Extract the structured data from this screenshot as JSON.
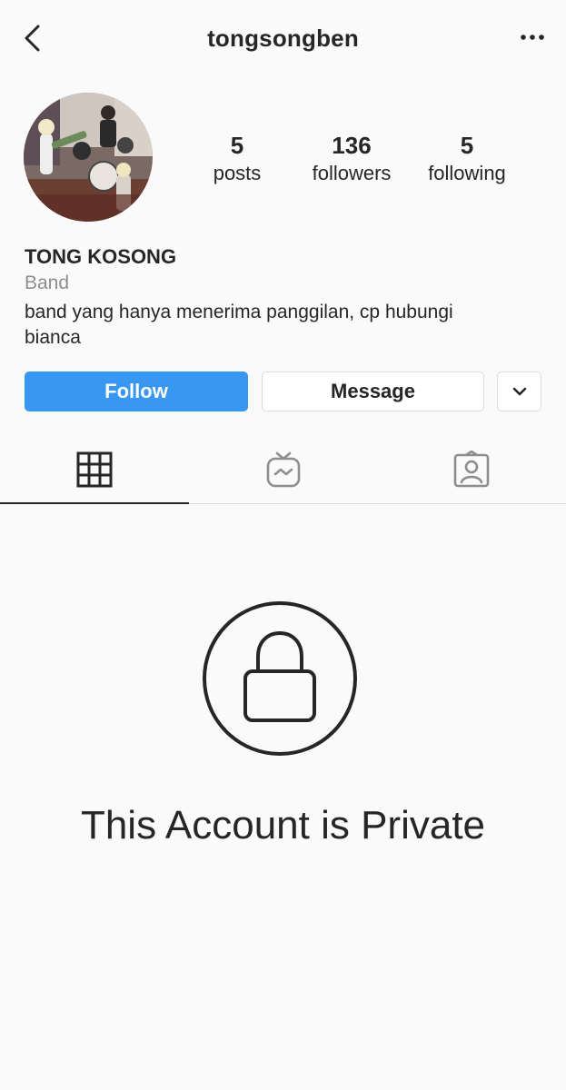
{
  "header": {
    "username": "tongsongben",
    "back_icon": "chevron-left-icon",
    "more_icon": "more-horizontal-icon"
  },
  "profile": {
    "avatar_icon": "profile-photo",
    "name": "TONG KOSONG",
    "category": "Band",
    "bio": "band yang hanya menerima panggilan, cp hubungi bianca"
  },
  "stats": [
    {
      "value": "5",
      "label": "posts"
    },
    {
      "value": "136",
      "label": "followers"
    },
    {
      "value": "5",
      "label": "following"
    }
  ],
  "actions": {
    "follow_label": "Follow",
    "message_label": "Message",
    "dropdown_icon": "chevron-down-icon"
  },
  "tabs": [
    {
      "icon": "grid-icon",
      "active": true
    },
    {
      "icon": "igtv-icon",
      "active": false
    },
    {
      "icon": "tagged-icon",
      "active": false
    }
  ],
  "private_notice": {
    "icon": "lock-icon",
    "title": "This Account is Private"
  },
  "colors": {
    "accent": "#3897f0",
    "text": "#262626",
    "muted": "#8e8e8e",
    "border": "#dbdbdb",
    "background": "#fafafa"
  }
}
